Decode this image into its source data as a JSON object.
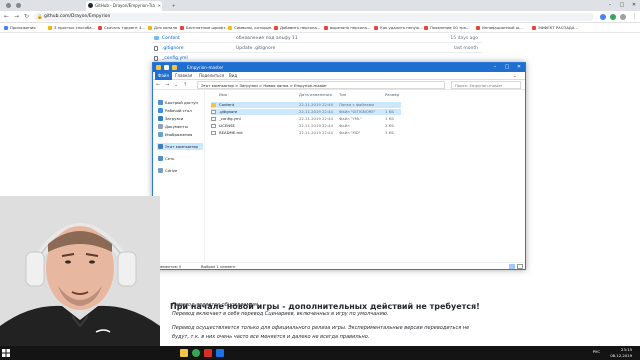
{
  "browser": {
    "tabs": [
      {
        "label": "GitHub - Drayon/Empyrion-Tra",
        "active": true
      },
      {
        "label": "",
        "active": false
      },
      {
        "label": "",
        "active": false
      }
    ],
    "url": "github.com/Drayon/Empyrion",
    "window_controls": {
      "minimize": "–",
      "maximize": "□",
      "close": "✕"
    }
  },
  "bookmarks": [
    "Приложения",
    "3 простых способа...",
    "Скачать торрент 4...",
    "Для канала",
    "Бесплатные шрифт...",
    "Символы, которые...",
    "Добавить персона...",
    "вырезано персона...",
    "Как удалить ненуж...",
    "Появление 00 тра...",
    "Инновационный ш...",
    "ЭФФЕКТ РАСПАДА..."
  ],
  "github": {
    "rows": [
      {
        "name": "Content",
        "message": "обновление под альфу 11",
        "age": "15 days ago",
        "type": "dir"
      },
      {
        "name": ".gitignore",
        "message": "Update .gitignore",
        "age": "last month",
        "type": "file"
      },
      {
        "name": "_config.yml",
        "message": "",
        "age": "",
        "type": "file"
      }
    ],
    "readme_title": "При начале новой игры - дополнительных действий не требуется!",
    "readme_lines": [
      "Перевод является обновляемым.",
      "Перевод включает в себя перевод Сценариев, включенных в игру по умолчанию.",
      "Перевод осуществляется только для официального релиза игры. Экспериментальные версии переводиться не",
      "будут, т.к. в них очень часто все меняется и далеко не всегда правильно."
    ]
  },
  "explorer": {
    "title": "Empyrion-master",
    "ribbon_tabs": [
      "Файл",
      "Главная",
      "Поделиться",
      "Вид"
    ],
    "path": "Этот компьютер  >  Загрузки  >  Новая папка  >  Empyrion-master",
    "search_placeholder": "Поиск: Empyrion-master",
    "nav_items": [
      "Быстрый доступ",
      "Рабочий стол",
      "Загрузки",
      "Документы",
      "Изображения",
      "Этот компьютер",
      "Сеть",
      "Cdrive"
    ],
    "columns": {
      "name": "Имя",
      "date": "Дата изменения",
      "type": "Тип",
      "size": "Размер"
    },
    "files": [
      {
        "name": "Content",
        "date": "22.11.2019 22:44",
        "type": "Папка с файлами",
        "size": "",
        "kind": "folder"
      },
      {
        "name": ".gitignore",
        "date": "22.11.2019 22:44",
        "type": "Файл \"GITIGNORE\"",
        "size": "1 КБ",
        "kind": "file"
      },
      {
        "name": "_config.yml",
        "date": "22.11.2019 22:44",
        "type": "Файл \"YML\"",
        "size": "1 КБ",
        "kind": "file"
      },
      {
        "name": "LICENSE",
        "date": "22.11.2019 22:44",
        "type": "Файл",
        "size": "2 КБ",
        "kind": "file"
      },
      {
        "name": "README.md",
        "date": "22.11.2019 22:44",
        "type": "Файл \"MD\"",
        "size": "3 КБ",
        "kind": "file"
      }
    ],
    "status_count": "Элементов: 5",
    "status_selected": "Выбран 1 элемент"
  },
  "taskbar": {
    "time": "23:15",
    "date": "08.12.2019",
    "lang": "РУС"
  },
  "colors": {
    "explorer_accent": "#1e6fd0",
    "selection": "#cce8ff",
    "link": "#0366d6"
  }
}
